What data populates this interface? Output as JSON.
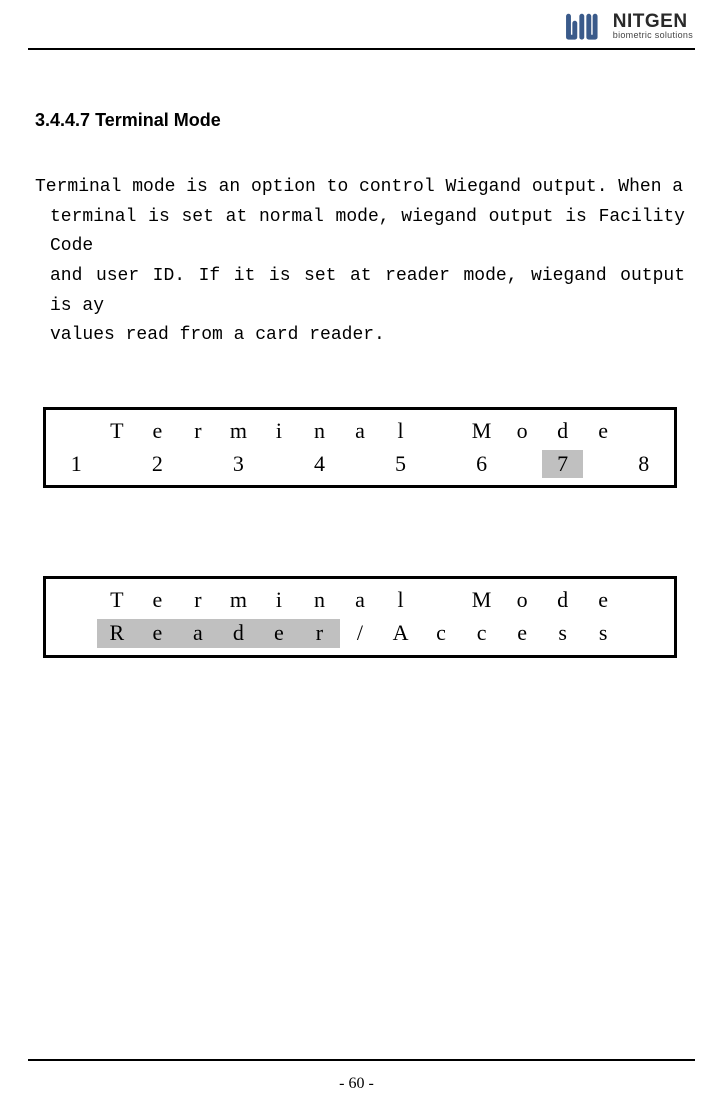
{
  "header": {
    "logo_main": "NITGEN",
    "logo_sub": "biometric solutions"
  },
  "section": {
    "number": "3.4.4.7",
    "title": "Terminal Mode"
  },
  "body": {
    "line1": "Terminal mode is an option to control Wiegand output. When a",
    "line2": "terminal is set at normal mode, wiegand output is Facility Code",
    "line3": "and user ID. If it is set at reader mode, wiegand output is ay",
    "line4": "values read from a card reader."
  },
  "box1": {
    "row1": [
      "",
      "T",
      "e",
      "r",
      "m",
      "i",
      "n",
      "a",
      "l",
      "",
      "M",
      "o",
      "d",
      "e",
      ""
    ],
    "row2": [
      "1",
      "",
      "2",
      "",
      "3",
      "",
      "4",
      "",
      "5",
      "",
      "6",
      "",
      "7",
      "",
      "8"
    ],
    "row2_highlight_index": 12
  },
  "box2": {
    "row1": [
      "",
      "T",
      "e",
      "r",
      "m",
      "i",
      "n",
      "a",
      "l",
      "",
      "M",
      "o",
      "d",
      "e",
      ""
    ],
    "row2": [
      "",
      "R",
      "e",
      "a",
      "d",
      "e",
      "r",
      "/",
      "A",
      "c",
      "c",
      "e",
      "s",
      "s",
      ""
    ],
    "row2_highlight_indices": [
      1,
      2,
      3,
      4,
      5,
      6
    ]
  },
  "footer": {
    "page_number": "- 60 -"
  }
}
